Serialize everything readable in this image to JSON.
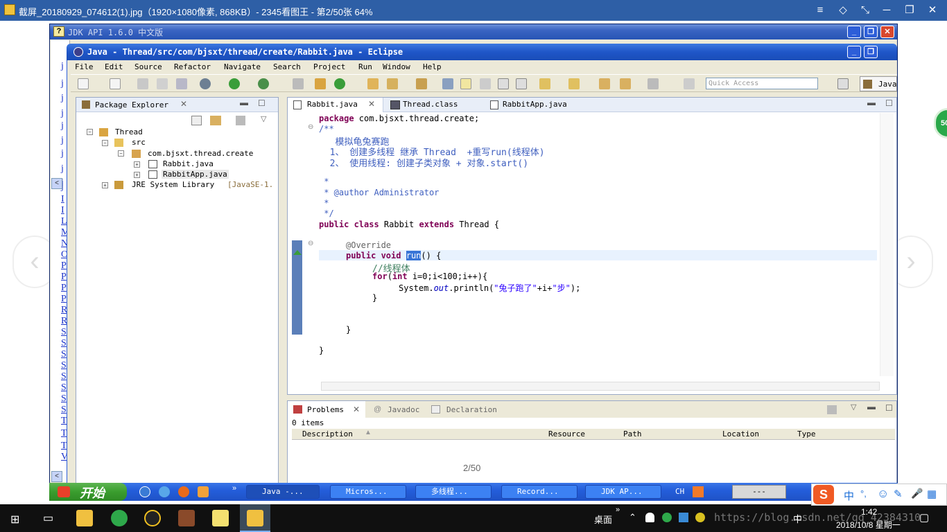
{
  "viewer": {
    "title": "截屏_20180929_074612(1).jpg（1920×1080像素, 868KB）- 2345看图王 - 第2/50张 64%",
    "page_indicator": "2/50",
    "buttons": [
      "≡",
      "◇",
      "⤡",
      "─",
      "❐",
      "✕"
    ]
  },
  "jdk": {
    "title": "JDK API 1.6.0 中文版",
    "left_letters": [
      "j",
      "j",
      "j",
      "j",
      "j",
      "j",
      "j",
      "j",
      "j",
      "j",
      "I",
      "I",
      "L",
      "M",
      "N",
      "O",
      "P",
      "P",
      "P",
      "P",
      "R",
      "R",
      "S",
      "S",
      "S",
      "S",
      "S",
      "S",
      "S",
      "S",
      "T",
      "T",
      "T",
      "V"
    ]
  },
  "eclipse": {
    "title": "Java - Thread/src/com/bjsxt/thread/create/Rabbit.java - Eclipse",
    "menu": [
      "File",
      "Edit",
      "Source",
      "Refactor",
      "Navigate",
      "Search",
      "Project",
      "Run",
      "Window",
      "Help"
    ],
    "quick_access": "Quick Access",
    "perspective": "Java"
  },
  "package_explorer": {
    "tab": "Package Explorer",
    "tree": {
      "project": "Thread",
      "src": "src",
      "package": "com.bjsxt.thread.create",
      "file1": "Rabbit.java",
      "file2": "RabbitApp.java",
      "jre": "JRE System Library",
      "jre_version": "[JavaSE-1."
    }
  },
  "editor": {
    "tabs": [
      "Rabbit.java",
      "Thread.class",
      "RabbitApp.java"
    ],
    "code": {
      "l1_kw": "package",
      "l1_rest": " com.bjsxt.thread.create;",
      "l2": "/**",
      "l3": "   模拟龟兔赛跑",
      "l4": "  1、 创建多线程 继承 Thread  +重写run(线程体)",
      "l5": "  2、 使用线程: 创建子类对象 + 对象.start()",
      "l6": " *",
      "l7": " * @author Administrator",
      "l8": " *",
      "l9": " */",
      "l10_a": "public class",
      "l10_b": " Rabbit ",
      "l10_c": "extends",
      "l10_d": " Thread {",
      "l11": "@Override",
      "l12_kw": "public void",
      "l12_sel": "run",
      "l12_rest": "() {",
      "l13": "//线程体",
      "l14_kw": "for",
      "l14_a": "(",
      "l14_int": "int",
      "l14_rest": " i=0;i<100;i++){",
      "l15_a": "System.",
      "l15_out": "out",
      "l15_b": ".println(",
      "l15_str": "\"兔子跑了\"",
      "l15_c": "+i+",
      "l15_str2": "\"步\"",
      "l15_d": ");",
      "l16": "}",
      "l17": "}",
      "l18": "}"
    }
  },
  "problems": {
    "tabs": [
      "Problems",
      "Javadoc",
      "Declaration"
    ],
    "count": "0 items",
    "columns": [
      "Description",
      "Resource",
      "Path",
      "Location",
      "Type"
    ]
  },
  "xp_taskbar": {
    "start": "开始",
    "tasks": [
      "Java -...",
      "Micros...",
      "多线程...",
      "Record...",
      "JDK AP..."
    ],
    "tray_lang": "CH",
    "tray_box": "---"
  },
  "taskbar": {
    "desktop_label": "桌面",
    "ime": "中",
    "time": "1:42",
    "date": "2018/10/8 星期一",
    "overlay": "https://blog.csdn.net/qq_42384310"
  },
  "ime_bar": {
    "items": [
      "中",
      "°,",
      "☺",
      "✎",
      "🎤",
      "▦"
    ]
  },
  "badge": "50"
}
